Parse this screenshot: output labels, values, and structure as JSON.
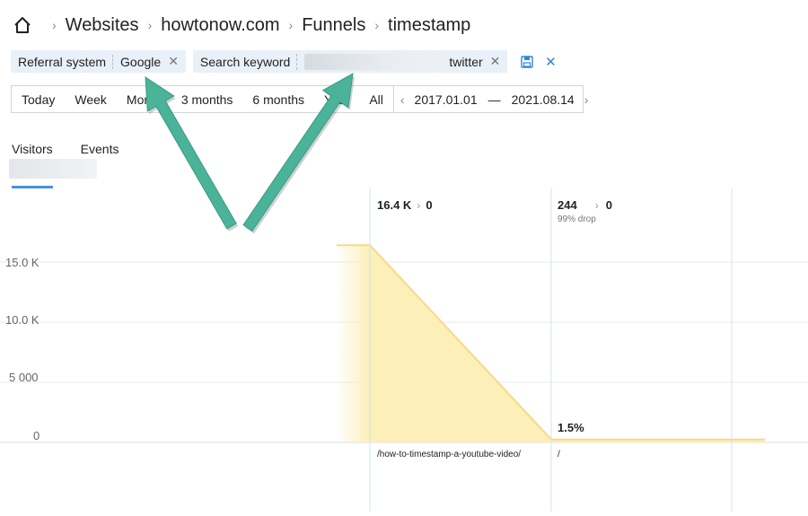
{
  "breadcrumb": {
    "items": [
      "Websites",
      "howtonow.com",
      "Funnels",
      "timestamp"
    ]
  },
  "filters": {
    "chips": [
      {
        "key": "Referral system",
        "value": "Google"
      },
      {
        "key": "Search keyword",
        "value": "twitter"
      }
    ]
  },
  "periods": {
    "options": [
      "Today",
      "Week",
      "Month",
      "3 months",
      "6 months",
      "Year",
      "All"
    ],
    "date_from": "2017.01.01",
    "date_to": "2021.08.14",
    "dash": "—"
  },
  "tabs": {
    "items": [
      "Visitors",
      "Events"
    ]
  },
  "chart_data": {
    "type": "area",
    "yticks": [
      "15.0 K",
      "10.0 K",
      "5 000",
      "0"
    ],
    "ylim": [
      0,
      18000
    ],
    "stages": [
      {
        "label": "/how-to-timestamp-a-youtube-video/",
        "value": 16400,
        "value_label": "16.4 K",
        "next": "0",
        "drop_label": ""
      },
      {
        "label": "/",
        "value": 244,
        "value_label": "244",
        "next": "0",
        "drop_label": "99% drop",
        "conversion_label": "1.5%"
      }
    ],
    "colors": {
      "fill": "#fcefb8",
      "line": "#f8d98a",
      "grid": "#e6e9ec",
      "vline": "#cfe3f3"
    }
  },
  "colors": {
    "accent": "#4a90e2",
    "chip_bg": "#e8f0f8",
    "arrow": "#4bb39a"
  }
}
